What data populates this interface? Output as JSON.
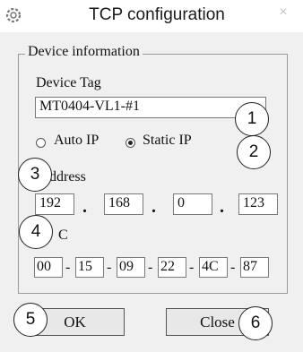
{
  "window": {
    "title": "TCP configuration",
    "close_glyph": "×",
    "app_icon": "gear-icon"
  },
  "device_info": {
    "group_label": "Device information",
    "device_tag_label": "Device Tag",
    "device_tag_value": "MT0404-VL1-#1"
  },
  "ip_mode": {
    "auto_label": "Auto IP",
    "static_label": "Static IP",
    "selected": "Static IP"
  },
  "ip_address": {
    "label": "ddress",
    "octets": [
      "192",
      "168",
      "0",
      "123"
    ],
    "separator": "."
  },
  "mac": {
    "label": "C",
    "bytes": [
      "00",
      "15",
      "09",
      "22",
      "4C",
      "87"
    ],
    "separator": "-"
  },
  "buttons": {
    "ok": "OK",
    "close": "Close"
  },
  "callouts": [
    "1",
    "2",
    "3",
    "4",
    "5",
    "6"
  ]
}
